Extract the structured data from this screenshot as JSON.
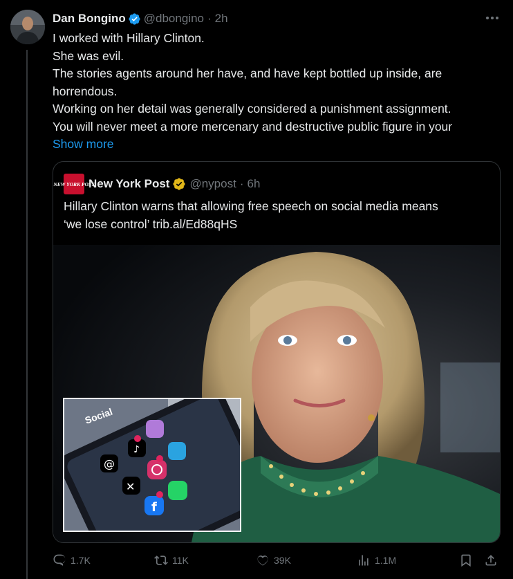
{
  "post": {
    "author_name": "Dan Bongino",
    "author_handle": "@dbongino",
    "time_sep": "·",
    "time": "2h",
    "lines": [
      "I worked with Hillary Clinton.",
      "She was evil.",
      "The stories agents around her have, and have kept bottled up inside, are",
      "horrendous.",
      "Working on her detail was generally considered a punishment assignment.",
      "You will never meet a more mercenary and destructive public figure in your"
    ],
    "show_more": "Show more"
  },
  "quote": {
    "logo_text": "NEW YORK POST",
    "author_name": "New York Post",
    "author_handle": "@nypost",
    "time_sep": "·",
    "time": "6h",
    "lines": [
      "Hillary Clinton warns that allowing free speech on social media means",
      "‘we lose control’ trib.al/Ed88qHS"
    ],
    "inset": {
      "folder_label": "Social",
      "apps": [
        "Threads",
        "TikTok",
        "Messenger",
        "Telegram",
        "Instagram",
        "X",
        "WhatsApp",
        "Facebook"
      ]
    }
  },
  "actions": {
    "replies": "1.7K",
    "reposts": "11K",
    "likes": "39K",
    "views": "1.1M"
  },
  "colors": {
    "background": "#000000",
    "text": "#e7e9ea",
    "muted": "#71767b",
    "link": "#1d9bf0",
    "verified_blue": "#1d9bf0",
    "verified_gold": "#e2b719",
    "nyp_red": "#c8102e"
  },
  "icons": [
    "reply-icon",
    "repost-icon",
    "like-icon",
    "views-icon",
    "bookmark-icon",
    "share-icon",
    "more-icon",
    "verified-icon"
  ]
}
